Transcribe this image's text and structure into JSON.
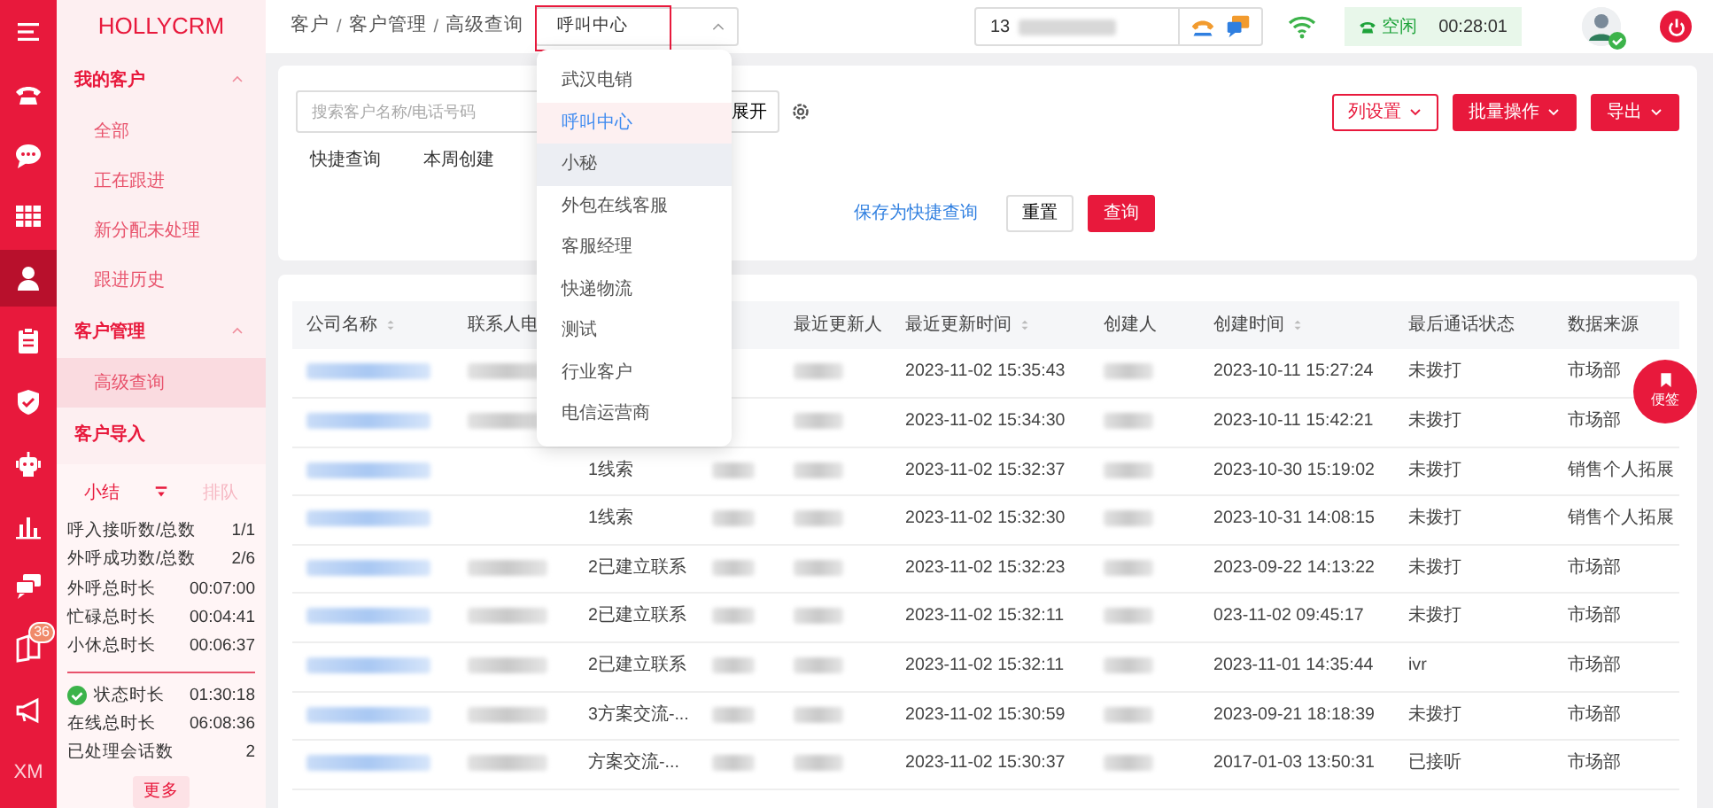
{
  "rail": [
    {
      "kind": "menu",
      "selected": false
    },
    {
      "kind": "phone",
      "selected": false
    },
    {
      "kind": "chat",
      "selected": false
    },
    {
      "kind": "grid",
      "selected": false
    },
    {
      "kind": "person",
      "selected": true
    },
    {
      "kind": "clipboard",
      "selected": false
    },
    {
      "kind": "shield",
      "selected": false
    },
    {
      "kind": "robot",
      "selected": false
    },
    {
      "kind": "chart",
      "selected": false
    },
    {
      "kind": "chats",
      "selected": false
    },
    {
      "kind": "book",
      "selected": false,
      "badge": "36"
    },
    {
      "kind": "megaphone",
      "selected": false
    },
    {
      "kind": "text",
      "selected": false,
      "text": "XM"
    }
  ],
  "logo": "HOLLYCRM",
  "menu": [
    {
      "label": "我的客户",
      "expanded": true,
      "items": [
        {
          "label": "全部",
          "selected": false
        },
        {
          "label": "正在跟进",
          "selected": false
        },
        {
          "label": "新分配未处理",
          "selected": false
        },
        {
          "label": "跟进历史",
          "selected": false
        }
      ]
    },
    {
      "label": "客户管理",
      "expanded": true,
      "items": [
        {
          "label": "高级查询",
          "selected": true
        }
      ]
    },
    {
      "label": "客户导入"
    }
  ],
  "summary": {
    "tabs": [
      {
        "label": "小结",
        "selected": true
      },
      {
        "label": "排队",
        "selected": false
      }
    ],
    "groups": [
      [
        {
          "label": "呼入接听数/总数",
          "value": "1/1"
        },
        {
          "label": "外呼成功数/总数",
          "value": "2/6"
        },
        {
          "label": "外呼总时长",
          "value": "00:07:00"
        },
        {
          "label": "忙碌总时长",
          "value": "00:04:41"
        },
        {
          "label": "小休总时长",
          "value": "00:06:37"
        }
      ],
      [
        {
          "label": "状态时长",
          "value": "01:30:18",
          "kind": "status"
        },
        {
          "label": "在线总时长",
          "value": "06:08:36"
        },
        {
          "label": "已处理会话数",
          "value": "2"
        }
      ]
    ],
    "more": "更多"
  },
  "breadcrumb": [
    {
      "kind": "crumb",
      "text": "客户"
    },
    {
      "kind": "separator",
      "text": "/"
    },
    {
      "kind": "crumb",
      "text": "客户管理"
    },
    {
      "kind": "separator",
      "text": "/"
    },
    {
      "kind": "crumb",
      "text": "高级查询"
    }
  ],
  "org_select": {
    "value": "呼叫中心",
    "expanded": true,
    "outlined": true,
    "options": [
      {
        "label": "武汉电销",
        "selected": false,
        "highlighted": false
      },
      {
        "label": "呼叫中心",
        "selected": true,
        "highlighted": false
      },
      {
        "label": "小秘",
        "selected": false,
        "highlighted": true
      },
      {
        "label": "外包在线客服",
        "selected": false,
        "highlighted": false
      },
      {
        "label": "客服经理",
        "selected": false,
        "highlighted": false
      },
      {
        "label": "快递物流",
        "selected": false,
        "highlighted": false
      },
      {
        "label": "测试",
        "selected": false,
        "highlighted": false
      },
      {
        "label": "行业客户",
        "selected": false,
        "highlighted": false
      },
      {
        "label": "电信运营商",
        "selected": false,
        "highlighted": false
      }
    ]
  },
  "phone": {
    "value": "13"
  },
  "agent_status": {
    "label": "空闲",
    "timer": "00:28:01"
  },
  "filter": {
    "search_placeholder": "搜索客户名称/电话号码",
    "expand_label": "展开",
    "actions": [
      {
        "label": "列设置",
        "kind": "outline"
      },
      {
        "label": "批量操作",
        "kind": "solid"
      },
      {
        "label": "导出",
        "kind": "solid"
      }
    ],
    "quick": [
      "快捷查询",
      "本周创建"
    ],
    "save_link": "保存为快捷查询",
    "reset": "重置",
    "query": "查询"
  },
  "table": {
    "columns": [
      {
        "label": "公司名称",
        "sortable": true
      },
      {
        "label": "联系人电"
      },
      null,
      null,
      {
        "label": "最近更新人"
      },
      {
        "label": "最近更新时间",
        "sortable": true
      },
      {
        "label": "创建人"
      },
      {
        "label": "创建时间",
        "sortable": true
      },
      {
        "label": "最后通话状态"
      },
      {
        "label": "数据来源"
      }
    ],
    "rows": [
      [
        {
          "kind": "blur-link"
        },
        {
          "kind": "blur"
        },
        null,
        null,
        {
          "kind": "blur"
        },
        "2023-11-02 15:35:43",
        {
          "kind": "blur"
        },
        "2023-10-11 15:27:24",
        "未拨打",
        "市场部"
      ],
      [
        {
          "kind": "blur-link"
        },
        {
          "kind": "blur"
        },
        null,
        null,
        {
          "kind": "blur"
        },
        "2023-11-02 15:34:30",
        {
          "kind": "blur"
        },
        "2023-10-11 15:42:21",
        "未拨打",
        "市场部"
      ],
      [
        {
          "kind": "blur-link"
        },
        null,
        "1线索",
        {
          "kind": "blur"
        },
        {
          "kind": "blur"
        },
        "2023-11-02 15:32:37",
        {
          "kind": "blur"
        },
        "2023-10-30 15:19:02",
        "未拨打",
        "销售个人拓展"
      ],
      [
        {
          "kind": "blur-link"
        },
        null,
        "1线索",
        {
          "kind": "blur"
        },
        {
          "kind": "blur"
        },
        "2023-11-02 15:32:30",
        {
          "kind": "blur"
        },
        "2023-10-31 14:08:15",
        "未拨打",
        "销售个人拓展"
      ],
      [
        {
          "kind": "blur-link"
        },
        {
          "kind": "blur"
        },
        "2已建立联系",
        {
          "kind": "blur"
        },
        {
          "kind": "blur"
        },
        "2023-11-02 15:32:23",
        {
          "kind": "blur"
        },
        "2023-09-22 14:13:22",
        "未拨打",
        "市场部"
      ],
      [
        {
          "kind": "blur-link"
        },
        {
          "kind": "blur"
        },
        "2已建立联系",
        {
          "kind": "blur"
        },
        {
          "kind": "blur"
        },
        "2023-11-02 15:32:11",
        {
          "kind": "blur"
        },
        "023-11-02 09:45:17",
        "未拨打",
        "市场部"
      ],
      [
        {
          "kind": "blur-link"
        },
        {
          "kind": "blur"
        },
        "2已建立联系",
        {
          "kind": "blur"
        },
        {
          "kind": "blur"
        },
        "2023-11-02 15:32:11",
        {
          "kind": "blur"
        },
        "2023-11-01 14:35:44",
        "ivr",
        "市场部"
      ],
      [
        {
          "kind": "blur-link"
        },
        {
          "kind": "blur"
        },
        "3方案交流-...",
        {
          "kind": "blur"
        },
        {
          "kind": "blur"
        },
        "2023-11-02 15:30:59",
        {
          "kind": "blur"
        },
        "2023-09-21 18:18:39",
        "未拨打",
        "市场部"
      ],
      [
        {
          "kind": "blur-link"
        },
        {
          "kind": "blur"
        },
        "方案交流-...",
        {
          "kind": "blur"
        },
        {
          "kind": "blur"
        },
        "2023-11-02 15:30:37",
        {
          "kind": "blur"
        },
        "2017-01-03 13:50:31",
        "已接听",
        "市场部"
      ]
    ]
  },
  "note_button": {
    "label": "便签"
  }
}
